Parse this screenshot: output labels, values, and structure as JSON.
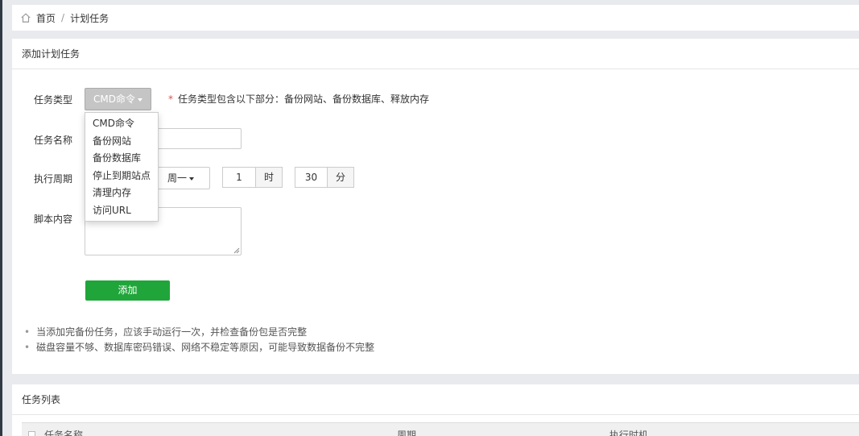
{
  "breadcrumb": {
    "home_label": "首页",
    "separator": "/",
    "current": "计划任务"
  },
  "add_panel": {
    "title": "添加计划任务",
    "labels": {
      "task_type": "任务类型",
      "task_name": "任务名称",
      "period": "执行周期",
      "script": "脚本内容"
    },
    "type_dropdown": {
      "selected": "CMD命令"
    },
    "hint": {
      "star": "*",
      "text": "任务类型包含以下部分：备份网站、备份数据库、释放内存"
    },
    "menu_items": [
      "CMD命令",
      "备份网站",
      "备份数据库",
      "停止到期站点",
      "清理内存",
      "访问URL"
    ],
    "period": {
      "weekday": "周一",
      "hour_value": "1",
      "hour_unit": "时",
      "minute_value": "30",
      "minute_unit": "分"
    },
    "add_button": "添加",
    "tips": [
      "当添加完备份任务，应该手动运行一次，并检查备份包是否完整",
      "磁盘容量不够、数据库密码错误、网络不稳定等原因，可能导致数据备份不完整"
    ]
  },
  "list_panel": {
    "title": "任务列表",
    "columns": [
      "任务名称",
      "周期",
      "执行时机"
    ]
  },
  "colors": {
    "accent_green": "#20a53a",
    "required_red": "#d9534f"
  }
}
